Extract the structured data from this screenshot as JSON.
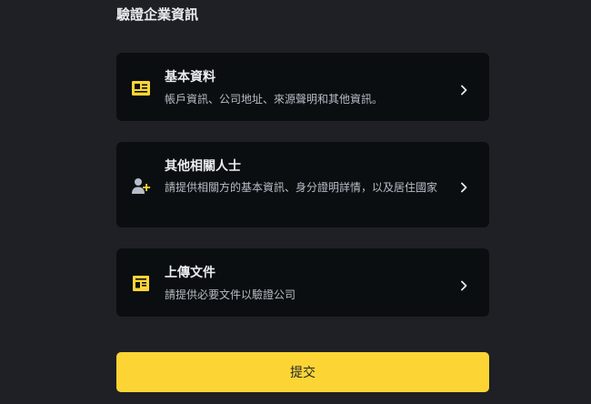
{
  "header": {
    "title": "驗證企業資訊"
  },
  "cards": [
    {
      "icon": "id-card-icon",
      "title": "基本資料",
      "description": "帳戶資訊、公司地址、來源聲明和其他資訊。"
    },
    {
      "icon": "add-person-icon",
      "title": "其他相關人士",
      "description": "請提供相關方的基本資訊、身分證明詳情，以及居住國家"
    },
    {
      "icon": "document-icon",
      "title": "上傳文件",
      "description": "請提供必要文件以驗證公司"
    }
  ],
  "footer": {
    "submit_label": "提交"
  },
  "colors": {
    "background": "#1e2025",
    "card": "#0b0e11",
    "accent": "#fcd535",
    "text_primary": "#eaecef",
    "text_secondary": "#b7bdc6"
  }
}
